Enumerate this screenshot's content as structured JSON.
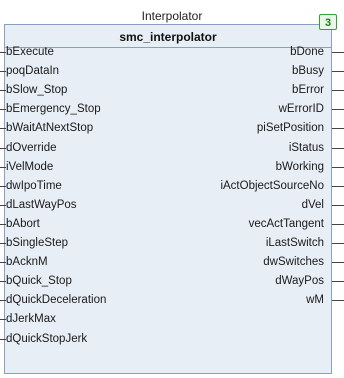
{
  "instance_name": "Interpolator",
  "type_name": "smc_interpolator",
  "execution_order": "3",
  "inputs": [
    "bExecute",
    "poqDataIn",
    "bSlow_Stop",
    "bEmergency_Stop",
    "bWaitAtNextStop",
    "dOverride",
    "iVelMode",
    "dwIpoTime",
    "dLastWayPos",
    "bAbort",
    "bSingleStep",
    "bAcknM",
    "bQuick_Stop",
    "dQuickDeceleration",
    "dJerkMax",
    "dQuickStopJerk"
  ],
  "outputs": [
    "bDone",
    "bBusy",
    "bError",
    "wErrorID",
    "piSetPosition",
    "iStatus",
    "bWorking",
    "iActObjectSourceNo",
    "dVel",
    "vecActTangent",
    "iLastSwitch",
    "dwSwitches",
    "dWayPos",
    "wM"
  ]
}
